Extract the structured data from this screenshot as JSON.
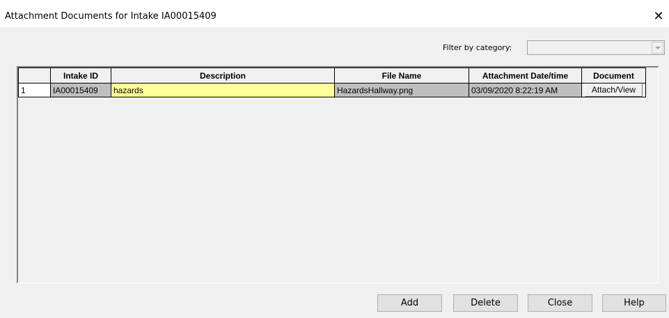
{
  "window": {
    "title": "Attachment Documents for Intake IA00015409",
    "close_glyph": "✕"
  },
  "filter": {
    "label": "Filter by category:",
    "selected": ""
  },
  "grid": {
    "columns": [
      "",
      "Intake ID",
      "Description",
      "File Name",
      "Attachment Date/time",
      "Document"
    ],
    "rows": [
      {
        "num": "1",
        "intake_id": "IA00015409",
        "description": "hazards",
        "file_name": "HazardsHallway.png",
        "date": "03/09/2020 8:22:19 AM",
        "document": "Attach/View"
      }
    ]
  },
  "buttons": {
    "add": "Add",
    "delete": "Delete",
    "close": "Close",
    "help": "Help"
  },
  "colors": {
    "description_cell": "#ffff99",
    "readonly_cell": "#bfbfbf"
  }
}
